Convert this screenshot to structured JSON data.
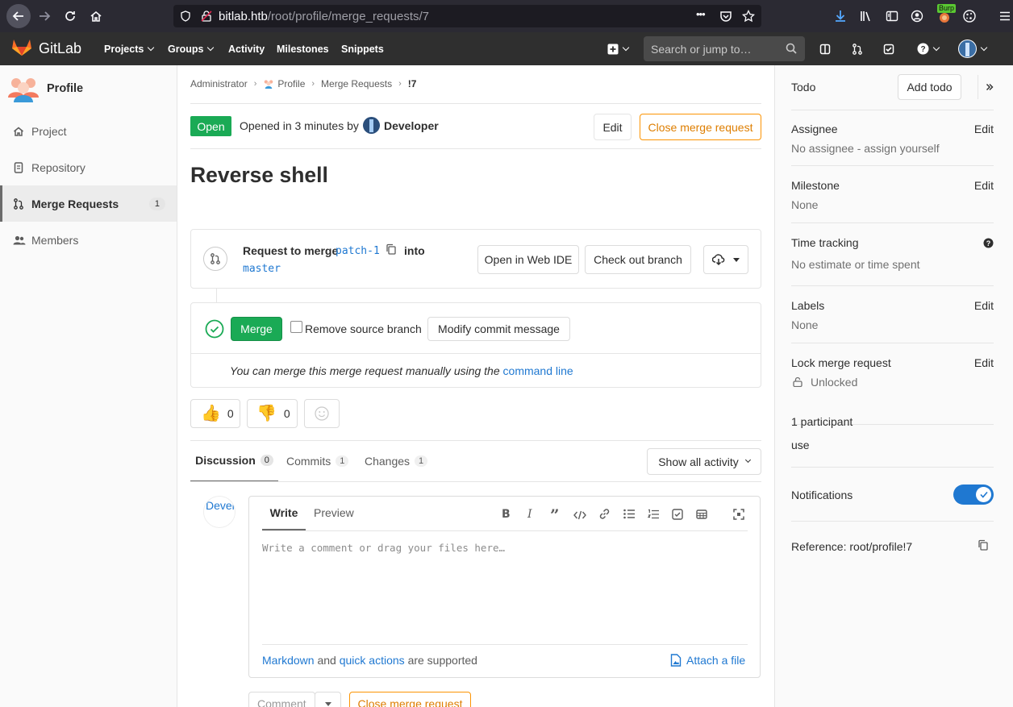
{
  "browser": {
    "url_host": "bitlab.htb",
    "url_path": "/root/profile/merge_requests/7",
    "menu_dots": "•••",
    "burp_label": "Burp"
  },
  "header": {
    "brand": "GitLab",
    "nav": [
      "Projects",
      "Groups",
      "Activity",
      "Milestones",
      "Snippets"
    ],
    "search_placeholder": "Search or jump to…"
  },
  "sidebar": {
    "project_title": "Profile",
    "items": [
      {
        "label": "Project",
        "icon": "home-icon"
      },
      {
        "label": "Repository",
        "icon": "doc-icon"
      },
      {
        "label": "Merge Requests",
        "icon": "merge-request-icon",
        "count": "1",
        "active": true
      },
      {
        "label": "Members",
        "icon": "users-icon"
      }
    ]
  },
  "breadcrumb": [
    "Administrator",
    "Profile",
    "Merge Requests",
    "!7"
  ],
  "mr": {
    "status": "Open",
    "opened_text": "Opened in 3 minutes by",
    "author": "Developer",
    "edit_label": "Edit",
    "close_label": "Close merge request",
    "title": "Reverse shell",
    "request_to_merge": "Request to merge",
    "source_branch": "patch-1",
    "into": "into",
    "target_branch": "master",
    "open_web_ide": "Open in Web IDE",
    "checkout_branch": "Check out branch",
    "merge_label": "Merge",
    "remove_source_branch": "Remove source branch",
    "modify_commit": "Modify commit message",
    "manual_merge_text": "You can merge this merge request manually using the",
    "command_line": "command line",
    "thumbs_up_count": "0",
    "thumbs_down_count": "0"
  },
  "tabs": [
    {
      "label": "Discussion",
      "count": "0",
      "active": true
    },
    {
      "label": "Commits",
      "count": "1"
    },
    {
      "label": "Changes",
      "count": "1"
    }
  ],
  "show_all_activity": "Show all activity",
  "comment": {
    "avatar_text": "Devel",
    "write_tab": "Write",
    "preview_tab": "Preview",
    "placeholder": "Write a comment or drag your files here…",
    "markdown": "Markdown",
    "and": "and",
    "quick_actions": "quick actions",
    "supported": "are supported",
    "attach": "Attach a file",
    "comment_button": "Comment",
    "close_button": "Close merge request"
  },
  "right_sidebar": {
    "todo": "Todo",
    "add_todo": "Add todo",
    "assignee_label": "Assignee",
    "assignee_value": "No assignee - assign yourself",
    "milestone_label": "Milestone",
    "milestone_value": "None",
    "time_tracking_label": "Time tracking",
    "time_tracking_value": "No estimate or time spent",
    "labels_label": "Labels",
    "labels_value": "None",
    "lock_label": "Lock merge request",
    "lock_value": "Unlocked",
    "participants_label": "1 participant",
    "participant": "use",
    "notifications_label": "Notifications",
    "notifications_on": true,
    "reference": "Reference: root/profile!7",
    "edit": "Edit"
  },
  "colors": {
    "green": "#1aaa55",
    "orange": "#fc9403",
    "link": "#1f78d1",
    "header": "#2f2f2f"
  }
}
